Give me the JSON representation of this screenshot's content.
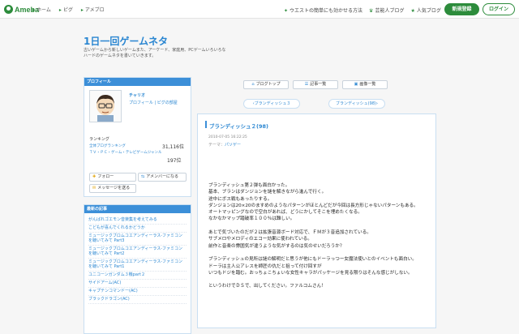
{
  "topbar": {
    "logo": "Ameba",
    "nav": [
      "ホーム",
      "ピグ",
      "アメブロ"
    ],
    "links": [
      "ウエストの簡単にも効かせる方法",
      "芸能人ブログ",
      "人気ブログ"
    ],
    "register": "新規登録",
    "login": "ログイン"
  },
  "blog": {
    "title": "1日一回ゲームネタ",
    "desc": "古いゲームから新しいゲームまた、アーケード、家庭用、PCゲームいろいろなハードのゲームネタを書いていきます。"
  },
  "profile": {
    "heading": "プロフィール",
    "name": "チャリオ",
    "links": "プロフィール | ピグの部屋",
    "ranking_label": "ランキング",
    "rank1_label": "全体ブログランキング",
    "rank1_value": "31,116位",
    "rank2_label": "ＴＶ・ＰＣ・ゲーム・テレビゲームジャンル",
    "rank2_value": "197位",
    "follow": "フォロー",
    "amember": "アメンバーになる",
    "message": "メッセージを送る"
  },
  "recent": {
    "heading": "最新の記事",
    "items": [
      "がんばれゴエモン音楽集を考えてみる",
      "こどもが喜んでくれるかどうか",
      "ミュージックブロムコエアンディーラス-ファミコンを聴いてみて Part3",
      "ミュージックブロムコエアンディーラス-ファミコンを聴いてみて Part2",
      "ミュージックブロムコエアンディーラス-ファミコンを聴いてみて Part1",
      "ユニコーンガンダム３機part２",
      "サイドアーム(AC)",
      "キャプテンコマンドー(AC)",
      "ブラックドラゴン(AC)"
    ]
  },
  "nav": {
    "top": "ブログトップ",
    "list": "記事一覧",
    "images": "画像一覧",
    "prev": "ブランディッシュ３",
    "next": "ブランディッシュ(98)"
  },
  "entry": {
    "title": "ブランディッシュ２(98)",
    "date": "2010-07-05 16:22:25",
    "theme_label": "テーマ：",
    "theme": "パソゲー",
    "body": [
      "ブランディッシュ第２弾も面白かった。",
      "基本、ブランはダンジョンを謎を解きながら進んで行く。",
      "途中にボス戦もあったりする。",
      "ダンジョンは20×20のますめのようなパターンがほとんどだが今回は長方形じゃないパターンもある。",
      "オートマッピングなので空白があれば、どうにかしてそこを埋めたくなる。",
      "なかなかマップ踏破率１００％は難しい。",
      "",
      "あとで気づいたのだが２は拡張音源ボード対応で、ＦＭが３音追加されている。",
      "サブメロやメロディのエコー効果に使われている。",
      "前作と音楽の雰囲気が違うような気がするのは気のせいだろうか？",
      "",
      "ブランディッシュの見所は謎の解明だと思うが他にもドーラっつー女魔法使いとのイベントも面白い。",
      "ドーラは主人公アレスを師匠の仇だと狙って付け回すが",
      "いつもドジを踏む。おっちょこちょいな女性キャラがパッケージを見る限りはそんな感じがしない。",
      "",
      "というわけでＤＳで、出してください。ファルコムさん！"
    ]
  }
}
